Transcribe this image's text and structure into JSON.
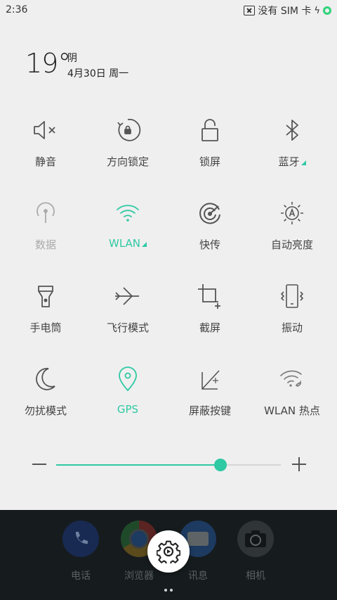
{
  "status_bar": {
    "time": "2:36",
    "carrier": "没有 SIM 卡"
  },
  "weather": {
    "temperature": "19°",
    "condition": "阴",
    "date": "4月30日 周一"
  },
  "tiles": [
    {
      "label": "静音",
      "icon": "mute-icon",
      "state": "off"
    },
    {
      "label": "方向锁定",
      "icon": "rotation-lock-icon",
      "state": "off"
    },
    {
      "label": "锁屏",
      "icon": "lock-icon",
      "state": "off"
    },
    {
      "label": "蓝牙",
      "icon": "bluetooth-icon",
      "state": "off",
      "expand": true
    },
    {
      "label": "数据",
      "icon": "mobile-data-icon",
      "state": "disabled"
    },
    {
      "label": "WLAN",
      "icon": "wifi-icon",
      "state": "on",
      "expand": true
    },
    {
      "label": "快传",
      "icon": "quick-transfer-icon",
      "state": "off"
    },
    {
      "label": "自动亮度",
      "icon": "auto-brightness-icon",
      "state": "off"
    },
    {
      "label": "手电筒",
      "icon": "flashlight-icon",
      "state": "off"
    },
    {
      "label": "飞行模式",
      "icon": "airplane-icon",
      "state": "off"
    },
    {
      "label": "截屏",
      "icon": "screenshot-icon",
      "state": "off"
    },
    {
      "label": "振动",
      "icon": "vibrate-icon",
      "state": "off"
    },
    {
      "label": "勿扰模式",
      "icon": "moon-icon",
      "state": "off"
    },
    {
      "label": "GPS",
      "icon": "location-icon",
      "state": "on"
    },
    {
      "label": "屏蔽按键",
      "icon": "block-keys-icon",
      "state": "off"
    },
    {
      "label": "WLAN 热点",
      "icon": "hotspot-icon",
      "state": "off"
    }
  ],
  "brightness": {
    "level": 0.73
  },
  "dock": [
    {
      "label": "电话",
      "icon": "phone-icon"
    },
    {
      "label": "浏览器",
      "icon": "browser-icon"
    },
    {
      "label": "讯息",
      "icon": "messages-icon"
    },
    {
      "label": "相机",
      "icon": "camera-icon"
    }
  ],
  "colors": {
    "accent": "#2fc9a3",
    "panel_bg": "#efefef",
    "dock_bg": "#161b1d"
  }
}
